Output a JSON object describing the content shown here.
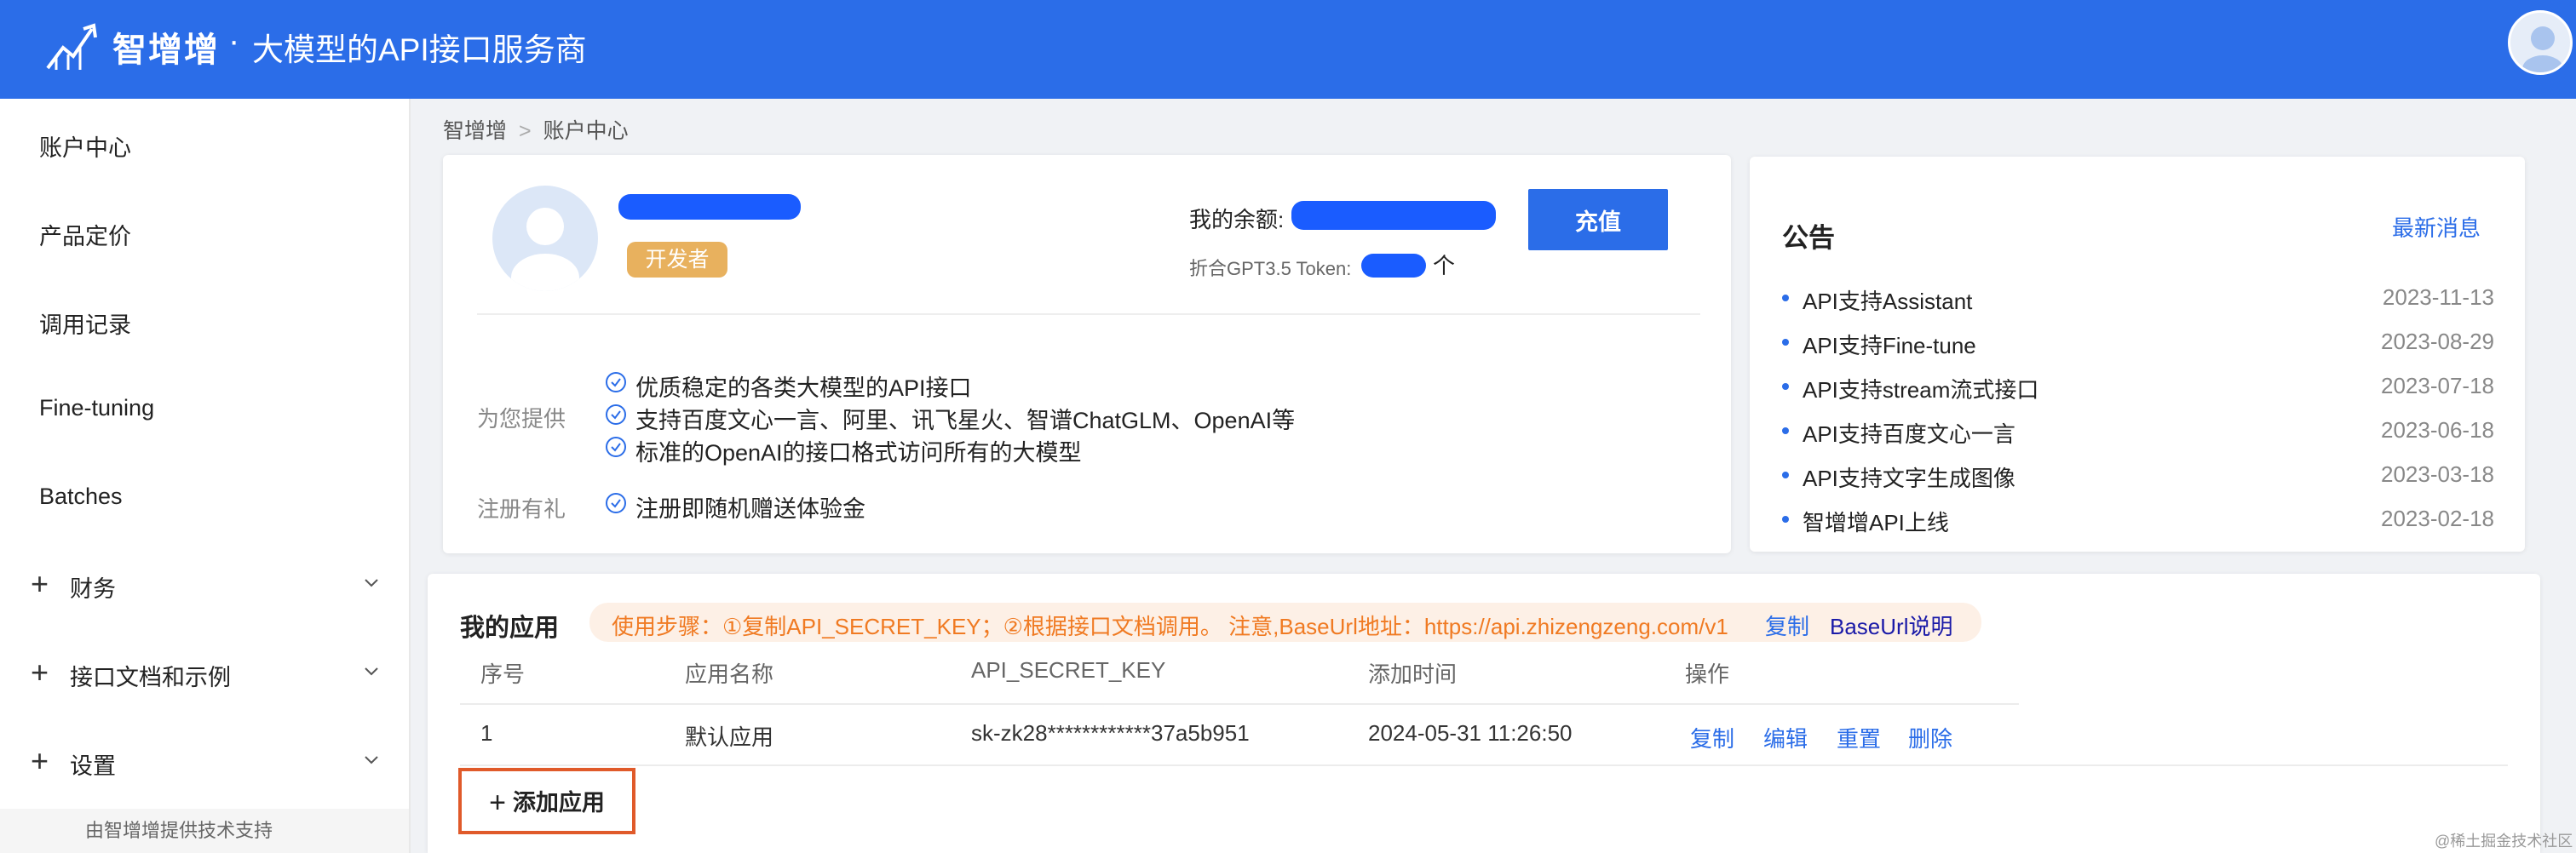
{
  "header": {
    "brand": "智增增",
    "separator": "·",
    "slogan": "大模型的API接口服务商"
  },
  "sidebar": {
    "items": [
      {
        "label": "账户中心"
      },
      {
        "label": "产品定价"
      },
      {
        "label": "调用记录"
      },
      {
        "label": "Fine-tuning"
      },
      {
        "label": "Batches"
      }
    ],
    "groups": [
      {
        "label": "财务",
        "icon": "plus-icon"
      },
      {
        "label": "接口文档和示例",
        "icon": "plus-icon"
      },
      {
        "label": "设置",
        "icon": "plus-icon"
      }
    ],
    "footer": "由智增增提供技术支持"
  },
  "breadcrumb": {
    "root": "智增增",
    "separator": ">",
    "current": "账户中心"
  },
  "account": {
    "role_badge": "开发者",
    "balance_label": "我的余额:",
    "tokens_label": "折合GPT3.5 Token:",
    "tokens_unit": "个",
    "recharge_button": "充值",
    "offer_label": "为您提供",
    "offers": [
      "优质稳定的各类大模型的API接口",
      "支持百度文心一言、阿里、讯飞星火、智谱ChatGLM、OpenAI等",
      "标准的OpenAI的接口格式访问所有的大模型"
    ],
    "gift_label": "注册有礼",
    "gift": "注册即随机赠送体验金"
  },
  "notice": {
    "title": "公告",
    "more": "最新消息",
    "items": [
      {
        "title": "API支持Assistant",
        "date": "2023-11-13"
      },
      {
        "title": "API支持Fine-tune",
        "date": "2023-08-29"
      },
      {
        "title": "API支持stream流式接口",
        "date": "2023-07-18"
      },
      {
        "title": "API支持百度文心一言",
        "date": "2023-06-18"
      },
      {
        "title": "API支持文字生成图像",
        "date": "2023-03-18"
      },
      {
        "title": "智增增API上线",
        "date": "2023-02-18"
      }
    ]
  },
  "apps": {
    "title": "我的应用",
    "tip": "使用步骤：①复制API_SECRET_KEY；②根据接口文档调用。 注意,BaseUrl地址：https://api.zhizengzeng.com/v1",
    "tip_copy": "复制",
    "tip_doc": "BaseUrl说明",
    "columns": [
      "序号",
      "应用名称",
      "API_SECRET_KEY",
      "添加时间",
      "操作"
    ],
    "rows": [
      {
        "index": "1",
        "name": "默认应用",
        "key": "sk-zk28************37a5b951",
        "added": "2024-05-31 11:26:50",
        "actions": [
          "复制",
          "编辑",
          "重置",
          "删除"
        ]
      }
    ],
    "add_button": "添加应用"
  },
  "watermark": "@稀土掘金技术社区",
  "colors": {
    "primary": "#2b6de8",
    "badge": "#e8b15e",
    "tip_text": "#f07a22",
    "highlight_border": "#e05a2a"
  }
}
